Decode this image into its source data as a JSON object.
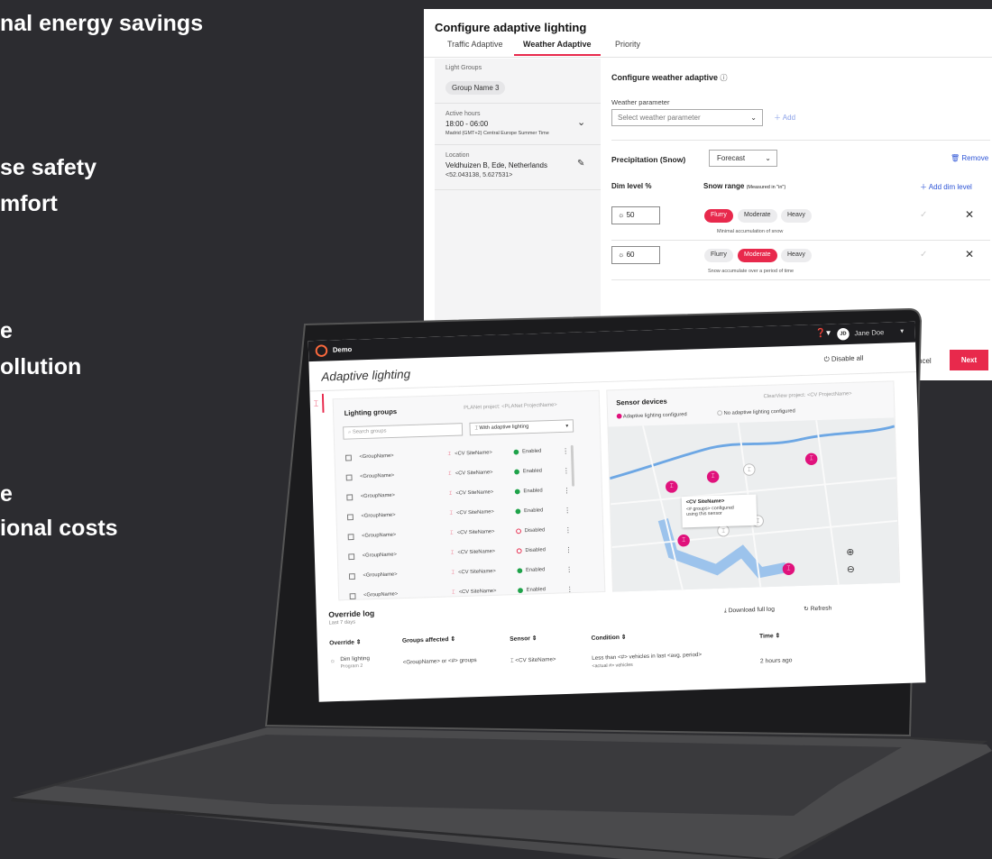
{
  "bullets": [
    "nal energy savings",
    "se safety",
    "mfort",
    "e",
    "ollution",
    "e",
    "ional costs"
  ],
  "modal": {
    "title": "Configure adaptive lighting",
    "tabs": [
      "Traffic Adaptive",
      "Weather Adaptive",
      "Priority"
    ],
    "left": {
      "groups_label": "Light Groups",
      "group_chip": "Group Name 3",
      "hours_label": "Active hours",
      "hours_value": "18:00 - 06:00",
      "timezone": "Madrid (GMT+2) Central Europe Summer Time",
      "location_label": "Location",
      "location_value": "Veldhuizen B, Ede, Netherlands",
      "coords": "<52.043138, 5.627531>"
    },
    "right": {
      "section_title": "Configure weather adaptive",
      "weather_param_label": "Weather parameter",
      "weather_param_placeholder": "Select weather parameter",
      "add_label": "Add",
      "precip_label": "Precipitation (Snow)",
      "forecast_value": "Forecast",
      "remove_label": "Remove",
      "dim_level_header": "Dim level %",
      "snow_range_header": "Snow range",
      "snow_range_hint": "(Measured in \"in\")",
      "add_dim_label": "Add dim level",
      "rows": [
        {
          "value": "50",
          "chips": [
            "Flurry",
            "Moderate",
            "Heavy"
          ],
          "active": 0,
          "note": "Minimal accumulation of snow"
        },
        {
          "value": "60",
          "chips": [
            "Flurry",
            "Moderate",
            "Heavy"
          ],
          "active": 1,
          "note": "Snow accumulate over a period of time"
        }
      ]
    },
    "cancel_label": "ncel",
    "next_label": "Next"
  },
  "app": {
    "org": "Demo",
    "user_initials": "JD",
    "user_name": "Jane Doe",
    "page_title": "Adaptive lighting",
    "disable_all": "Disable all",
    "groups": {
      "title": "Lighting groups",
      "project": "PLANet project: <PLANet ProjectName>",
      "search_placeholder": "Search groups",
      "filter": "With adaptive lighting",
      "rows": [
        {
          "name": "<GroupName>",
          "site": "<CV SiteName>",
          "status": "Enabled"
        },
        {
          "name": "<GroupName>",
          "site": "<CV SiteName>",
          "status": "Enabled"
        },
        {
          "name": "<GroupName>",
          "site": "<CV SiteName>",
          "status": "Enabled"
        },
        {
          "name": "<GroupName>",
          "site": "<CV SiteName>",
          "status": "Enabled"
        },
        {
          "name": "<GroupName>",
          "site": "<CV SiteName>",
          "status": "Disabled"
        },
        {
          "name": "<GroupName>",
          "site": "<CV SiteName>",
          "status": "Disabled"
        },
        {
          "name": "<GroupName>",
          "site": "<CV SiteName>",
          "status": "Enabled"
        },
        {
          "name": "<GroupName>",
          "site": "<CV SiteName>",
          "status": "Enabled"
        }
      ]
    },
    "sensors": {
      "title": "Sensor devices",
      "project": "ClearView project: <CV ProjectName>",
      "legend_configured": "Adaptive lighting configured",
      "legend_none": "No adaptive lighting configured",
      "tooltip_title": "<CV SiteName>",
      "tooltip_line1": "<# groups> configured",
      "tooltip_line2": "using this sensor"
    },
    "log": {
      "title": "Override log",
      "subtitle": "Last 7 days",
      "download": "Download full log",
      "refresh": "Refresh",
      "cols": [
        "Override",
        "Groups affected",
        "Sensor",
        "Condition",
        "Time"
      ],
      "row": {
        "override": "Dim lighting",
        "program": "Program 2",
        "groups": "<GroupName> or <#> groups",
        "sensor": "<CV SiteName>",
        "condition": "Less than <#> vehicles in last <avg. period>",
        "condition_sub": "<actual #> vehicles",
        "time": "2 hours ago"
      }
    }
  },
  "colors": {
    "accent": "#e8294c",
    "link": "#2e55d6",
    "enabled": "#1fa34a",
    "disabled": "#e8294c",
    "pin": "#e0127c"
  }
}
